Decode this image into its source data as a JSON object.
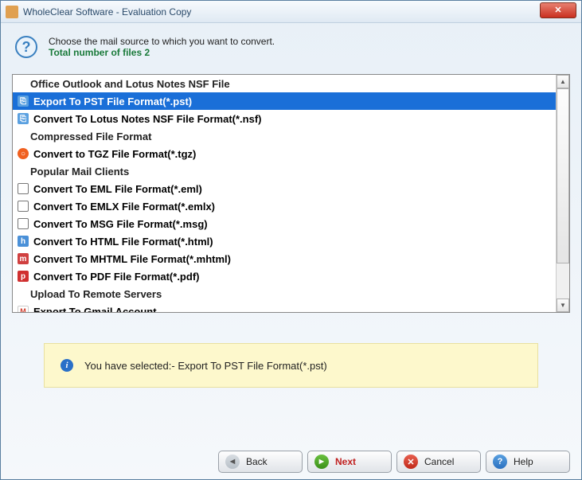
{
  "window": {
    "title": "WholeClear Software - Evaluation Copy"
  },
  "header": {
    "prompt": "Choose the mail source to which you want to convert.",
    "file_count_label": "Total number of files 2"
  },
  "list": {
    "groups": [
      {
        "title": "Office Outlook and Lotus Notes NSF File"
      },
      {
        "title": "Compressed File Format"
      },
      {
        "title": "Popular Mail Clients"
      },
      {
        "title": "Upload To Remote Servers"
      }
    ],
    "items": {
      "pst": "Export To PST File Format(*.pst)",
      "nsf": "Convert To Lotus Notes NSF File Format(*.nsf)",
      "tgz": "Convert to TGZ File Format(*.tgz)",
      "eml": "Convert To EML File Format(*.eml)",
      "emlx": "Convert To EMLX File Format(*.emlx)",
      "msg": "Convert To MSG File Format(*.msg)",
      "html": "Convert To HTML File Format(*.html)",
      "mhtml": "Convert To MHTML File Format(*.mhtml)",
      "pdf": "Convert To PDF File Format(*.pdf)",
      "gmail": "Export To Gmail Account"
    }
  },
  "status": {
    "prefix": "You have selected:- ",
    "value": "Export To PST File Format(*.pst)"
  },
  "buttons": {
    "back": "Back",
    "next": "Next",
    "cancel": "Cancel",
    "help": "Help"
  }
}
